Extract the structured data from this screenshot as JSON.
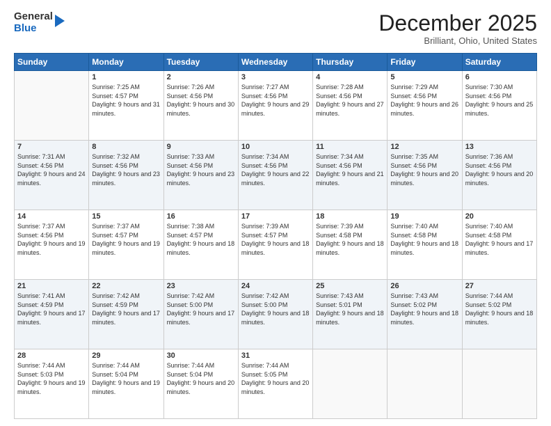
{
  "logo": {
    "general": "General",
    "blue": "Blue"
  },
  "header": {
    "month": "December 2025",
    "location": "Brilliant, Ohio, United States"
  },
  "days_of_week": [
    "Sunday",
    "Monday",
    "Tuesday",
    "Wednesday",
    "Thursday",
    "Friday",
    "Saturday"
  ],
  "weeks": [
    [
      {
        "day": "",
        "sunrise": "",
        "sunset": "",
        "daylight": ""
      },
      {
        "day": "1",
        "sunrise": "Sunrise: 7:25 AM",
        "sunset": "Sunset: 4:57 PM",
        "daylight": "Daylight: 9 hours and 31 minutes."
      },
      {
        "day": "2",
        "sunrise": "Sunrise: 7:26 AM",
        "sunset": "Sunset: 4:56 PM",
        "daylight": "Daylight: 9 hours and 30 minutes."
      },
      {
        "day": "3",
        "sunrise": "Sunrise: 7:27 AM",
        "sunset": "Sunset: 4:56 PM",
        "daylight": "Daylight: 9 hours and 29 minutes."
      },
      {
        "day": "4",
        "sunrise": "Sunrise: 7:28 AM",
        "sunset": "Sunset: 4:56 PM",
        "daylight": "Daylight: 9 hours and 27 minutes."
      },
      {
        "day": "5",
        "sunrise": "Sunrise: 7:29 AM",
        "sunset": "Sunset: 4:56 PM",
        "daylight": "Daylight: 9 hours and 26 minutes."
      },
      {
        "day": "6",
        "sunrise": "Sunrise: 7:30 AM",
        "sunset": "Sunset: 4:56 PM",
        "daylight": "Daylight: 9 hours and 25 minutes."
      }
    ],
    [
      {
        "day": "7",
        "sunrise": "Sunrise: 7:31 AM",
        "sunset": "Sunset: 4:56 PM",
        "daylight": "Daylight: 9 hours and 24 minutes."
      },
      {
        "day": "8",
        "sunrise": "Sunrise: 7:32 AM",
        "sunset": "Sunset: 4:56 PM",
        "daylight": "Daylight: 9 hours and 23 minutes."
      },
      {
        "day": "9",
        "sunrise": "Sunrise: 7:33 AM",
        "sunset": "Sunset: 4:56 PM",
        "daylight": "Daylight: 9 hours and 23 minutes."
      },
      {
        "day": "10",
        "sunrise": "Sunrise: 7:34 AM",
        "sunset": "Sunset: 4:56 PM",
        "daylight": "Daylight: 9 hours and 22 minutes."
      },
      {
        "day": "11",
        "sunrise": "Sunrise: 7:34 AM",
        "sunset": "Sunset: 4:56 PM",
        "daylight": "Daylight: 9 hours and 21 minutes."
      },
      {
        "day": "12",
        "sunrise": "Sunrise: 7:35 AM",
        "sunset": "Sunset: 4:56 PM",
        "daylight": "Daylight: 9 hours and 20 minutes."
      },
      {
        "day": "13",
        "sunrise": "Sunrise: 7:36 AM",
        "sunset": "Sunset: 4:56 PM",
        "daylight": "Daylight: 9 hours and 20 minutes."
      }
    ],
    [
      {
        "day": "14",
        "sunrise": "Sunrise: 7:37 AM",
        "sunset": "Sunset: 4:56 PM",
        "daylight": "Daylight: 9 hours and 19 minutes."
      },
      {
        "day": "15",
        "sunrise": "Sunrise: 7:37 AM",
        "sunset": "Sunset: 4:57 PM",
        "daylight": "Daylight: 9 hours and 19 minutes."
      },
      {
        "day": "16",
        "sunrise": "Sunrise: 7:38 AM",
        "sunset": "Sunset: 4:57 PM",
        "daylight": "Daylight: 9 hours and 18 minutes."
      },
      {
        "day": "17",
        "sunrise": "Sunrise: 7:39 AM",
        "sunset": "Sunset: 4:57 PM",
        "daylight": "Daylight: 9 hours and 18 minutes."
      },
      {
        "day": "18",
        "sunrise": "Sunrise: 7:39 AM",
        "sunset": "Sunset: 4:58 PM",
        "daylight": "Daylight: 9 hours and 18 minutes."
      },
      {
        "day": "19",
        "sunrise": "Sunrise: 7:40 AM",
        "sunset": "Sunset: 4:58 PM",
        "daylight": "Daylight: 9 hours and 18 minutes."
      },
      {
        "day": "20",
        "sunrise": "Sunrise: 7:40 AM",
        "sunset": "Sunset: 4:58 PM",
        "daylight": "Daylight: 9 hours and 17 minutes."
      }
    ],
    [
      {
        "day": "21",
        "sunrise": "Sunrise: 7:41 AM",
        "sunset": "Sunset: 4:59 PM",
        "daylight": "Daylight: 9 hours and 17 minutes."
      },
      {
        "day": "22",
        "sunrise": "Sunrise: 7:42 AM",
        "sunset": "Sunset: 4:59 PM",
        "daylight": "Daylight: 9 hours and 17 minutes."
      },
      {
        "day": "23",
        "sunrise": "Sunrise: 7:42 AM",
        "sunset": "Sunset: 5:00 PM",
        "daylight": "Daylight: 9 hours and 17 minutes."
      },
      {
        "day": "24",
        "sunrise": "Sunrise: 7:42 AM",
        "sunset": "Sunset: 5:00 PM",
        "daylight": "Daylight: 9 hours and 18 minutes."
      },
      {
        "day": "25",
        "sunrise": "Sunrise: 7:43 AM",
        "sunset": "Sunset: 5:01 PM",
        "daylight": "Daylight: 9 hours and 18 minutes."
      },
      {
        "day": "26",
        "sunrise": "Sunrise: 7:43 AM",
        "sunset": "Sunset: 5:02 PM",
        "daylight": "Daylight: 9 hours and 18 minutes."
      },
      {
        "day": "27",
        "sunrise": "Sunrise: 7:44 AM",
        "sunset": "Sunset: 5:02 PM",
        "daylight": "Daylight: 9 hours and 18 minutes."
      }
    ],
    [
      {
        "day": "28",
        "sunrise": "Sunrise: 7:44 AM",
        "sunset": "Sunset: 5:03 PM",
        "daylight": "Daylight: 9 hours and 19 minutes."
      },
      {
        "day": "29",
        "sunrise": "Sunrise: 7:44 AM",
        "sunset": "Sunset: 5:04 PM",
        "daylight": "Daylight: 9 hours and 19 minutes."
      },
      {
        "day": "30",
        "sunrise": "Sunrise: 7:44 AM",
        "sunset": "Sunset: 5:04 PM",
        "daylight": "Daylight: 9 hours and 20 minutes."
      },
      {
        "day": "31",
        "sunrise": "Sunrise: 7:44 AM",
        "sunset": "Sunset: 5:05 PM",
        "daylight": "Daylight: 9 hours and 20 minutes."
      },
      {
        "day": "",
        "sunrise": "",
        "sunset": "",
        "daylight": ""
      },
      {
        "day": "",
        "sunrise": "",
        "sunset": "",
        "daylight": ""
      },
      {
        "day": "",
        "sunrise": "",
        "sunset": "",
        "daylight": ""
      }
    ]
  ]
}
